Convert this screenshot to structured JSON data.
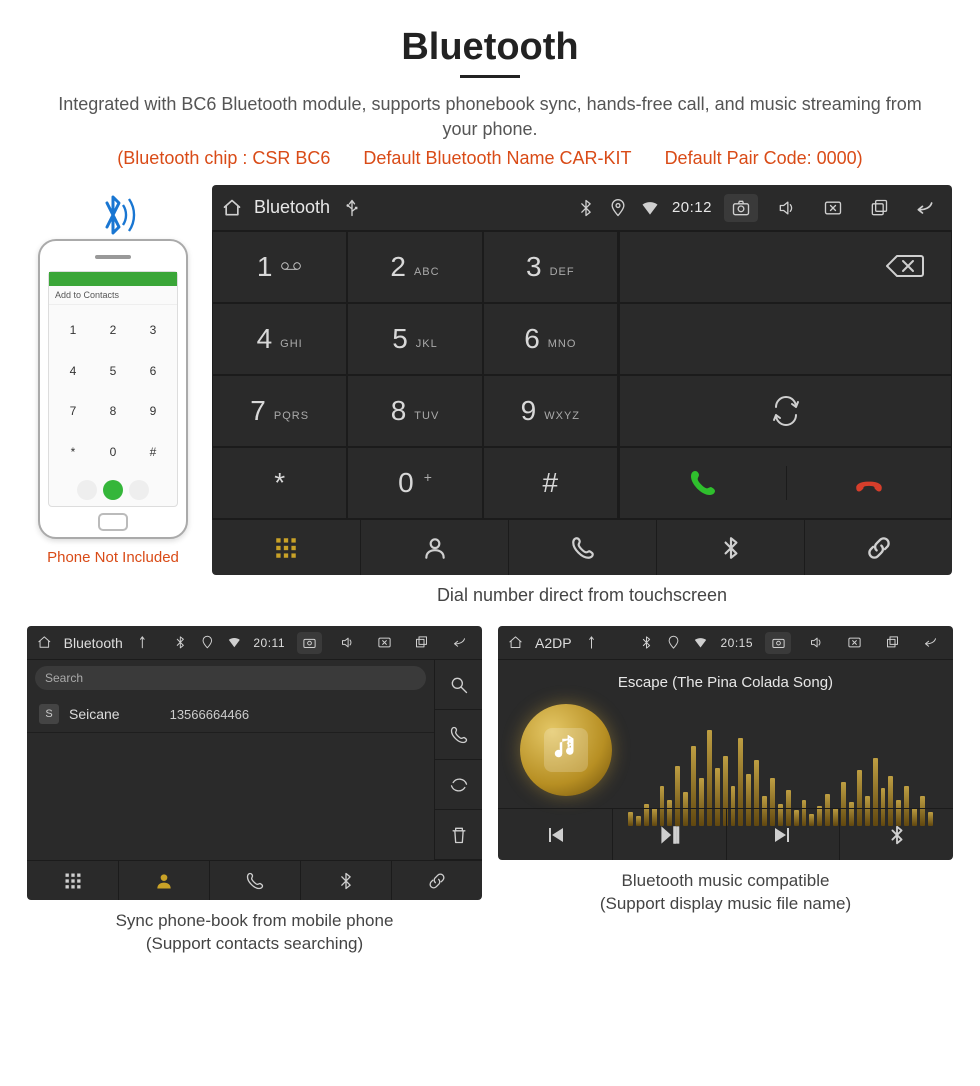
{
  "page": {
    "title": "Bluetooth",
    "intro": "Integrated with BC6 Bluetooth module, supports phonebook sync, hands-free call, and music streaming from your phone.",
    "spec_chip": "(Bluetooth chip : CSR BC6",
    "spec_name": "Default Bluetooth Name CAR-KIT",
    "spec_code": "Default Pair Code: 0000)"
  },
  "phone_illustration": {
    "add_to_contacts": "Add to Contacts",
    "caption": "Phone Not Included"
  },
  "dialer": {
    "title": "Bluetooth",
    "time": "20:12",
    "keys": [
      {
        "num": "1",
        "sub": ""
      },
      {
        "num": "2",
        "sub": "ABC"
      },
      {
        "num": "3",
        "sub": "DEF"
      },
      {
        "num": "4",
        "sub": "GHI"
      },
      {
        "num": "5",
        "sub": "JKL"
      },
      {
        "num": "6",
        "sub": "MNO"
      },
      {
        "num": "7",
        "sub": "PQRS"
      },
      {
        "num": "8",
        "sub": "TUV"
      },
      {
        "num": "9",
        "sub": "WXYZ"
      },
      {
        "num": "*",
        "sub": ""
      },
      {
        "num": "0",
        "sub": "+"
      },
      {
        "num": "#",
        "sub": ""
      }
    ],
    "caption": "Dial number direct from touchscreen"
  },
  "contacts_unit": {
    "title": "Bluetooth",
    "time": "20:11",
    "search_placeholder": "Search",
    "contact_badge": "S",
    "contact_name": "Seicane",
    "contact_number": "13566664466",
    "caption_line1": "Sync phone-book from mobile phone",
    "caption_line2": "(Support contacts searching)"
  },
  "music_unit": {
    "title": "A2DP",
    "time": "20:15",
    "track": "Escape (The Pina Colada Song)",
    "caption_line1": "Bluetooth music compatible",
    "caption_line2": "(Support display music file name)"
  }
}
